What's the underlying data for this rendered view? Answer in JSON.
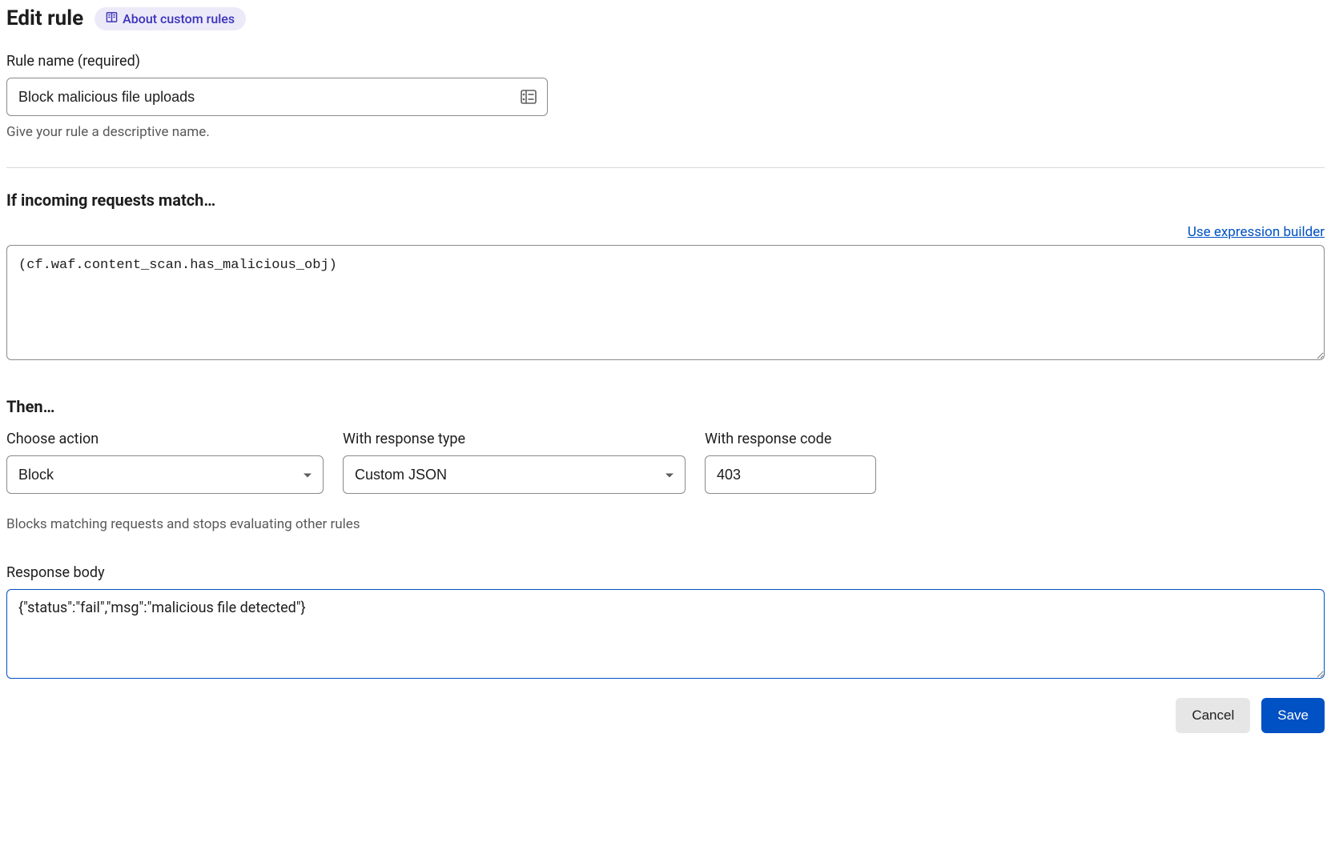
{
  "header": {
    "title": "Edit rule",
    "about_link": "About custom rules"
  },
  "rule_name": {
    "label": "Rule name (required)",
    "value": "Block malicious file uploads",
    "help": "Give your rule a descriptive name."
  },
  "match_section": {
    "title": "If incoming requests match…",
    "builder_link": "Use expression builder",
    "expression": "(cf.waf.content_scan.has_malicious_obj)"
  },
  "then_section": {
    "title": "Then…",
    "action": {
      "label": "Choose action",
      "value": "Block"
    },
    "response_type": {
      "label": "With response type",
      "value": "Custom JSON"
    },
    "response_code": {
      "label": "With response code",
      "value": "403"
    },
    "description": "Blocks matching requests and stops evaluating other rules"
  },
  "response_body": {
    "label": "Response body",
    "value": "{\"status\":\"fail\",\"msg\":\"malicious file detected\"}"
  },
  "footer": {
    "cancel": "Cancel",
    "save": "Save"
  }
}
